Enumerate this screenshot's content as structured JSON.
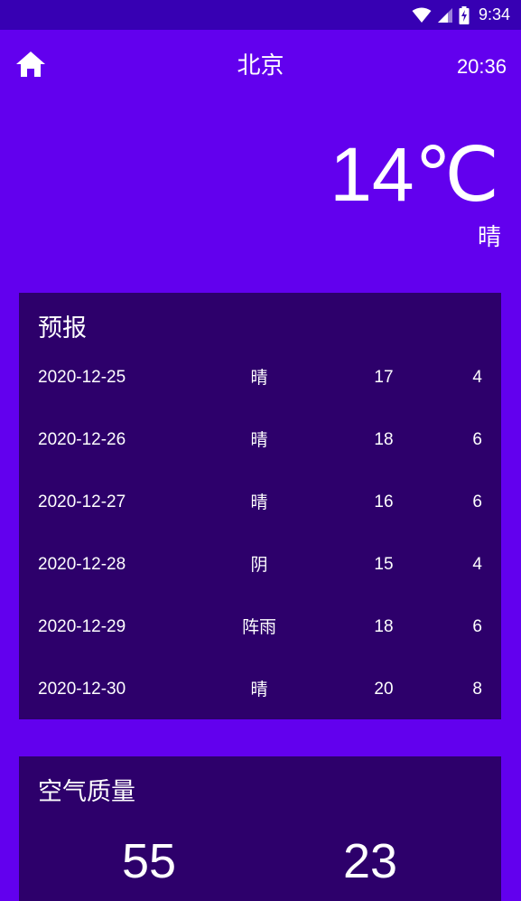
{
  "status_bar": {
    "time": "9:34",
    "icons": [
      "wifi-icon",
      "cellular-signal-icon",
      "battery-charging-icon"
    ]
  },
  "header": {
    "home_icon": "home-icon",
    "city": "北京",
    "update_time": "20:36"
  },
  "now": {
    "temperature": "14℃",
    "weather": "晴"
  },
  "forecast": {
    "title": "预报",
    "rows": [
      {
        "date": "2020-12-25",
        "weather": "晴",
        "max": "17",
        "min": "4"
      },
      {
        "date": "2020-12-26",
        "weather": "晴",
        "max": "18",
        "min": "6"
      },
      {
        "date": "2020-12-27",
        "weather": "晴",
        "max": "16",
        "min": "6"
      },
      {
        "date": "2020-12-28",
        "weather": "阴",
        "max": "15",
        "min": "4"
      },
      {
        "date": "2020-12-29",
        "weather": "阵雨",
        "max": "18",
        "min": "6"
      },
      {
        "date": "2020-12-30",
        "weather": "晴",
        "max": "20",
        "min": "8"
      }
    ]
  },
  "aqi": {
    "title": "空气质量",
    "aqi_value": "55",
    "pm25_value": "23"
  },
  "colors": {
    "background": "#6200EE",
    "status_bar": "#3700B3",
    "card": "#2D006B"
  }
}
